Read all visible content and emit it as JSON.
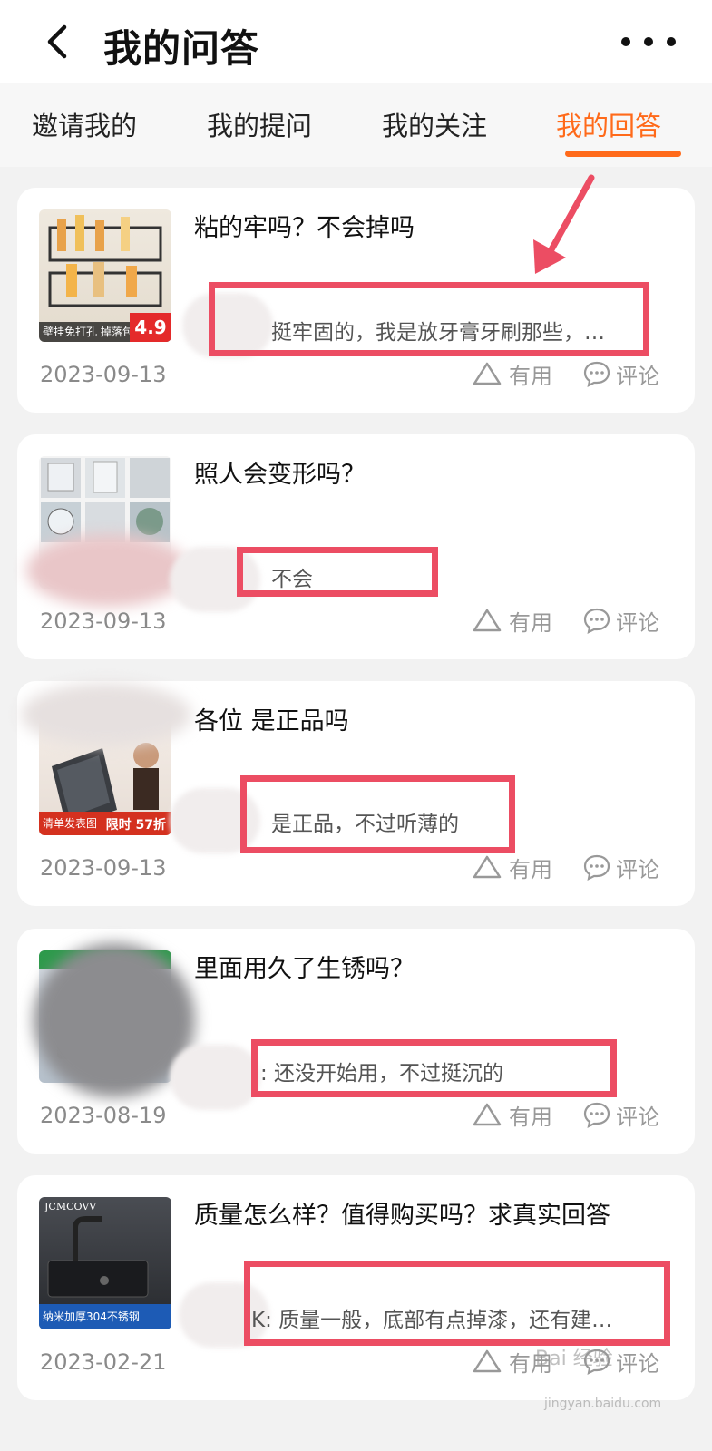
{
  "header": {
    "title": "我的问答"
  },
  "tabs": [
    {
      "label": "邀请我的",
      "active": false
    },
    {
      "label": "我的提问",
      "active": false
    },
    {
      "label": "我的关注",
      "active": false
    },
    {
      "label": "我的回答",
      "active": true
    }
  ],
  "accent_color": "#ff6a1a",
  "highlight_color": "#ec4d63",
  "cards": [
    {
      "question": "粘的牢吗？不会掉吗",
      "answer": "挺牢固的，我是放牙膏牙刷那些，…",
      "date": "2023-09-13",
      "useful_label": "有用",
      "comment_label": "评论",
      "thumb_caption": "壁挂免打孔 掉落包赔",
      "thumb_price": "4.9"
    },
    {
      "question": "照人会变形吗？",
      "answer": "不会",
      "date": "2023-09-13",
      "useful_label": "有用",
      "comment_label": "评论"
    },
    {
      "question": "各位 是正品吗",
      "answer": "是正品，不过听薄的",
      "date": "2023-09-13",
      "useful_label": "有用",
      "comment_label": "评论",
      "thumb_caption": "清单发表图",
      "thumb_badge": "限时 57折"
    },
    {
      "question": "里面用久了生锈吗？",
      "answer": ": 还没开始用，不过挺沉的",
      "date": "2023-08-19",
      "useful_label": "有用",
      "comment_label": "评论"
    },
    {
      "question": "质量怎么样？值得购买吗？求真实回答",
      "answer": "K: 质量一般，底部有点掉漆，还有建…",
      "date": "2023-02-21",
      "useful_label": "有用",
      "comment_label": "评论",
      "thumb_brand": "JCMCOVV",
      "thumb_caption": "纳米加厚304不锈钢"
    }
  ],
  "watermark": {
    "text": "Bai 经验",
    "sub": "jingyan.baidu.com"
  }
}
